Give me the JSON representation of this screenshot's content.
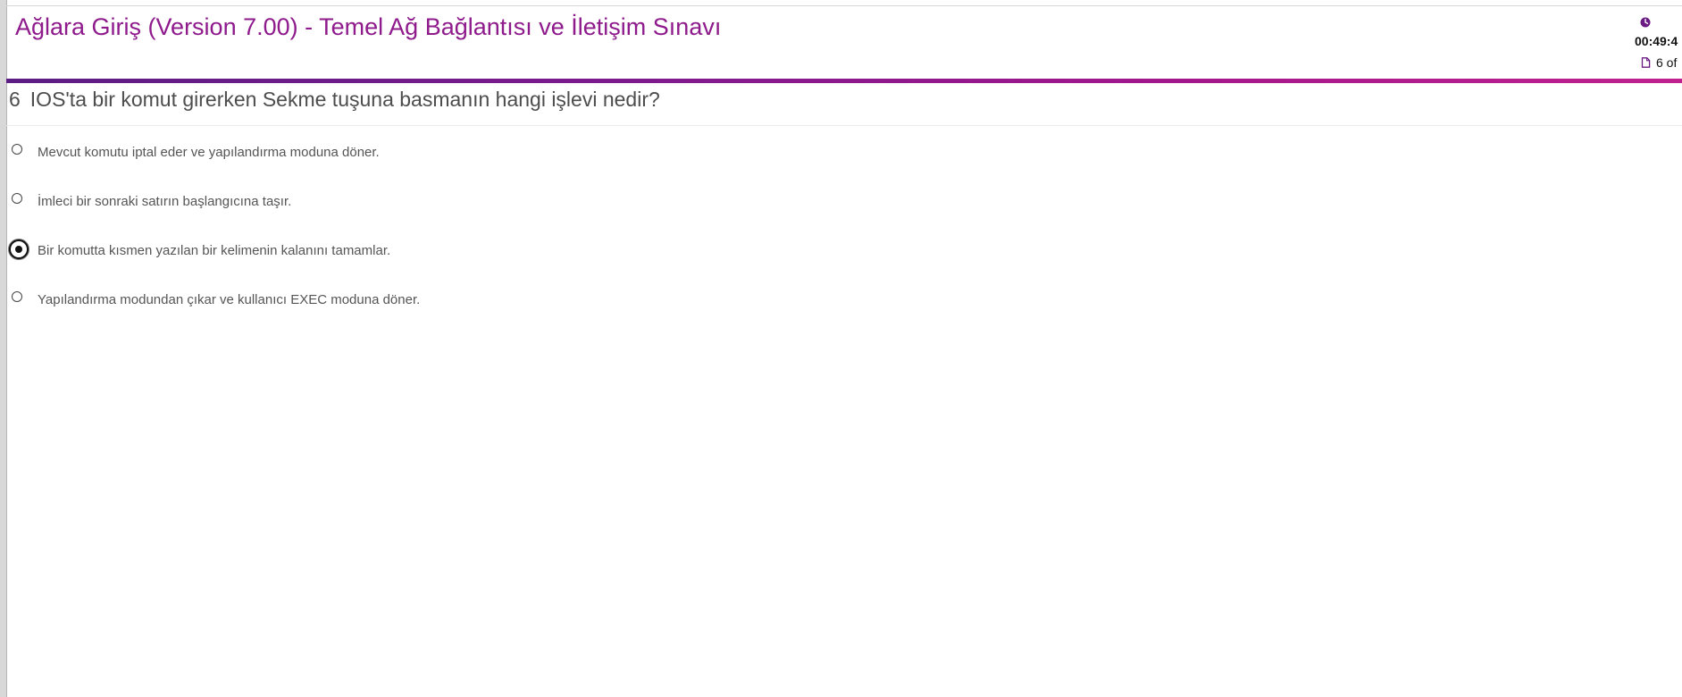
{
  "header": {
    "title": "Ağlara Giriş (Version 7.00) - Temel Ağ Bağlantısı ve İletişim Sınavı",
    "timer": "00:49:4",
    "progress": "6 of",
    "clock_icon": "clock-icon",
    "page_icon": "page-icon"
  },
  "colors": {
    "title": "#8e1a8c",
    "accent_start": "#5c1d84",
    "accent_end": "#c0218f",
    "question_text": "#4d4d4d",
    "option_text": "#555555"
  },
  "question": {
    "number": "6",
    "text": "IOS'ta bir komut girerken Sekme tuşuna basmanın hangi işlevi nedir?",
    "options": [
      {
        "label": "Mevcut komutu iptal eder ve yapılandırma moduna döner.",
        "selected": false
      },
      {
        "label": "İmleci bir sonraki satırın başlangıcına taşır.",
        "selected": false
      },
      {
        "label": "Bir komutta kısmen yazılan bir kelimenin kalanını tamamlar.",
        "selected": true
      },
      {
        "label": "Yapılandırma modundan çıkar ve kullanıcı EXEC moduna döner.",
        "selected": false
      }
    ]
  }
}
